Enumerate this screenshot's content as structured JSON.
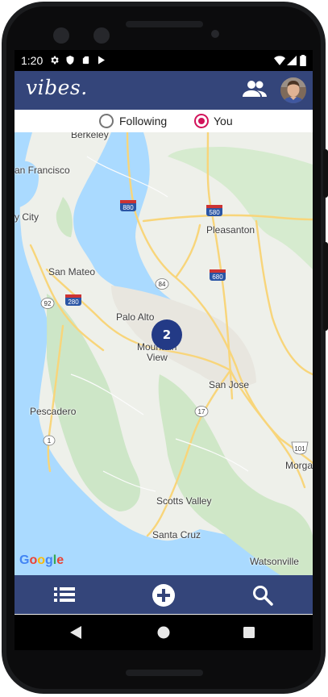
{
  "status_bar": {
    "time": "1:20"
  },
  "app_bar": {
    "logo": "vibes."
  },
  "filter": {
    "options": [
      {
        "label": "Following",
        "selected": false
      },
      {
        "label": "You",
        "selected": true
      }
    ],
    "accent": "#d2135a"
  },
  "map": {
    "labels": {
      "berkeley": "Berkeley",
      "san_francisco": "an Francisco",
      "daly_city": "y City",
      "pleasanton": "Pleasanton",
      "san_mateo": "San Mateo",
      "palo_alto": "Palo Alto",
      "mountain_view_1": "Mountain",
      "mountain_view_2": "View",
      "san_jose": "San Jose",
      "pescadero": "Pescadero",
      "scotts_valley": "Scotts Valley",
      "santa_cruz": "Santa Cruz",
      "watsonville": "Watsonville",
      "morgan_hill": "Morga"
    },
    "shields": {
      "i880": "880",
      "i580": "580",
      "i680": "680",
      "i280": "280",
      "r84": "84",
      "r92": "92",
      "r17": "17",
      "r1": "1",
      "us101": "101"
    },
    "cluster_count": "2",
    "attribution": "Google"
  },
  "bottom_nav": {
    "icons": [
      "list-icon",
      "add-circle-icon",
      "search-icon"
    ]
  },
  "colors": {
    "app_bar": "#34457a",
    "cluster": "#233a86"
  }
}
